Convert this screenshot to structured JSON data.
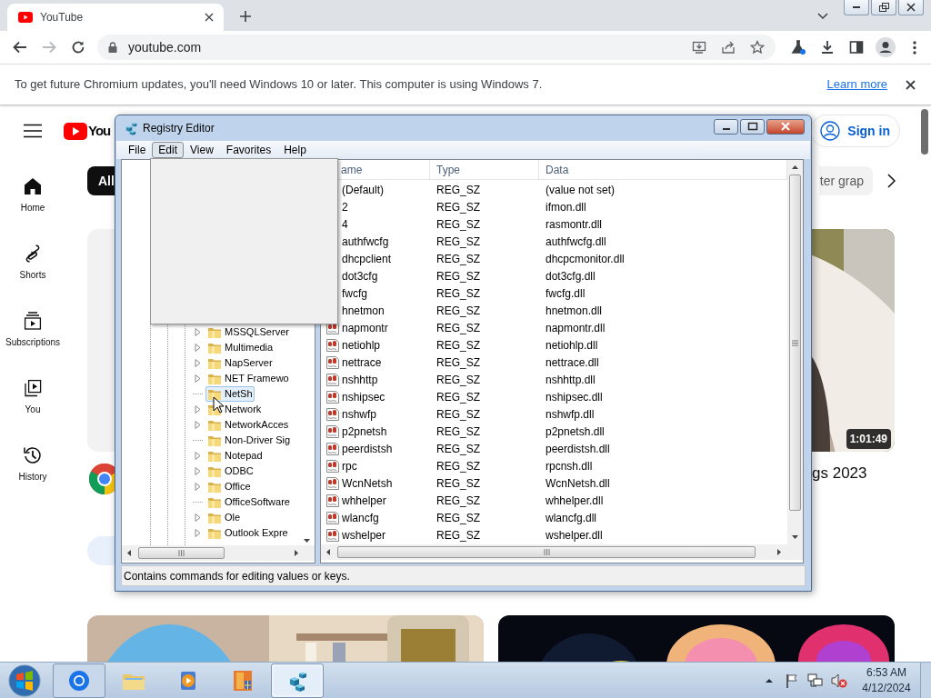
{
  "browser": {
    "tab": {
      "title": "YouTube"
    },
    "address": "youtube.com",
    "infobar": {
      "message": "To get future Chromium updates, you'll need Windows 10 or later. This computer is using Windows 7.",
      "link": "Learn more"
    }
  },
  "youtube": {
    "logo": "You",
    "sign_in": "Sign in",
    "nav": [
      {
        "label": "Home"
      },
      {
        "label": "Shorts"
      },
      {
        "label": "Subscriptions"
      },
      {
        "label": "You"
      },
      {
        "label": "History"
      }
    ],
    "chips": [
      {
        "label": "All",
        "selected": true
      },
      {
        "label": "ter grap",
        "selected": false
      }
    ],
    "videos": [
      {
        "kind": "placeholder"
      },
      {
        "kind": "picture",
        "duration": "1:01:49",
        "title": "gs 2023"
      },
      {
        "kind": "picture"
      },
      {
        "kind": "picture"
      }
    ]
  },
  "registry": {
    "title": "Registry Editor",
    "menu": [
      {
        "label": "File",
        "selected": false
      },
      {
        "label": "Edit",
        "selected": true
      },
      {
        "label": "View",
        "selected": false
      },
      {
        "label": "Favorites",
        "selected": false
      },
      {
        "label": "Help",
        "selected": false
      }
    ],
    "tree": [
      {
        "label": "MSSQLServer",
        "expandable": true,
        "selected": false
      },
      {
        "label": "Multimedia",
        "expandable": true,
        "selected": false
      },
      {
        "label": "NapServer",
        "expandable": true,
        "selected": false
      },
      {
        "label": "NET Framewo",
        "expandable": true,
        "selected": false
      },
      {
        "label": "NetSh",
        "expandable": false,
        "selected": true
      },
      {
        "label": "Network",
        "expandable": true,
        "selected": false
      },
      {
        "label": "NetworkAcces",
        "expandable": true,
        "selected": false
      },
      {
        "label": "Non-Driver Sig",
        "expandable": false,
        "selected": false
      },
      {
        "label": "Notepad",
        "expandable": true,
        "selected": false
      },
      {
        "label": "ODBC",
        "expandable": true,
        "selected": false
      },
      {
        "label": "Office",
        "expandable": true,
        "selected": false
      },
      {
        "label": "OfficeSoftware",
        "expandable": false,
        "selected": false
      },
      {
        "label": "Ole",
        "expandable": true,
        "selected": false
      },
      {
        "label": "Outlook Expre",
        "expandable": true,
        "selected": false
      }
    ],
    "columns": [
      "ame",
      "Type",
      "Data"
    ],
    "rows": [
      {
        "name": "(Default)",
        "type": "REG_SZ",
        "data": "(value not set)",
        "icon": false
      },
      {
        "name": "2",
        "type": "REG_SZ",
        "data": "ifmon.dll",
        "icon": false
      },
      {
        "name": "4",
        "type": "REG_SZ",
        "data": "rasmontr.dll",
        "icon": false
      },
      {
        "name": "authfwcfg",
        "type": "REG_SZ",
        "data": "authfwcfg.dll",
        "icon": false
      },
      {
        "name": "dhcpclient",
        "type": "REG_SZ",
        "data": "dhcpcmonitor.dll",
        "icon": false
      },
      {
        "name": "dot3cfg",
        "type": "REG_SZ",
        "data": "dot3cfg.dll",
        "icon": false
      },
      {
        "name": "fwcfg",
        "type": "REG_SZ",
        "data": "fwcfg.dll",
        "icon": false
      },
      {
        "name": "hnetmon",
        "type": "REG_SZ",
        "data": "hnetmon.dll",
        "icon": false
      },
      {
        "name": "napmontr",
        "type": "REG_SZ",
        "data": "napmontr.dll",
        "icon": true
      },
      {
        "name": "netiohlp",
        "type": "REG_SZ",
        "data": "netiohlp.dll",
        "icon": true
      },
      {
        "name": "nettrace",
        "type": "REG_SZ",
        "data": "nettrace.dll",
        "icon": true
      },
      {
        "name": "nshhttp",
        "type": "REG_SZ",
        "data": "nshhttp.dll",
        "icon": true
      },
      {
        "name": "nshipsec",
        "type": "REG_SZ",
        "data": "nshipsec.dll",
        "icon": true
      },
      {
        "name": "nshwfp",
        "type": "REG_SZ",
        "data": "nshwfp.dll",
        "icon": true
      },
      {
        "name": "p2pnetsh",
        "type": "REG_SZ",
        "data": "p2pnetsh.dll",
        "icon": true
      },
      {
        "name": "peerdistsh",
        "type": "REG_SZ",
        "data": "peerdistsh.dll",
        "icon": true
      },
      {
        "name": "rpc",
        "type": "REG_SZ",
        "data": "rpcnsh.dll",
        "icon": true
      },
      {
        "name": "WcnNetsh",
        "type": "REG_SZ",
        "data": "WcnNetsh.dll",
        "icon": true
      },
      {
        "name": "whhelper",
        "type": "REG_SZ",
        "data": "whhelper.dll",
        "icon": true
      },
      {
        "name": "wlancfg",
        "type": "REG_SZ",
        "data": "wlancfg.dll",
        "icon": true
      },
      {
        "name": "wshelper",
        "type": "REG_SZ",
        "data": "wshelper.dll",
        "icon": true
      }
    ],
    "status": "Contains commands for editing values or keys."
  },
  "taskbar": {
    "apps": [
      {
        "kind": "browser",
        "running": true,
        "selected": false
      },
      {
        "kind": "explorer",
        "running": false,
        "selected": false
      },
      {
        "kind": "media",
        "running": false,
        "selected": false
      },
      {
        "kind": "installer",
        "running": false,
        "selected": false
      },
      {
        "kind": "registry",
        "running": true,
        "selected": true
      }
    ],
    "clock": {
      "time": "6:53 AM",
      "date": "4/12/2024"
    }
  }
}
